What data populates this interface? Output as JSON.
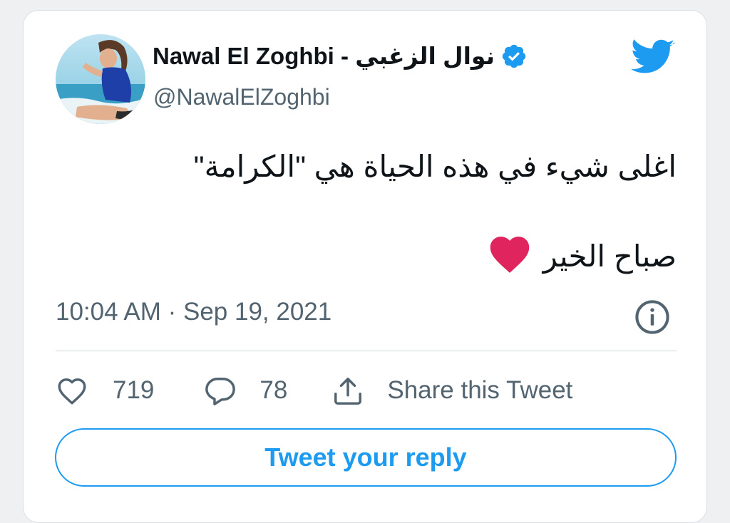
{
  "tweet": {
    "display_name": "Nawal El Zoghbi - نوال الزغبي",
    "handle": "@NawalElZoghbi",
    "verified": true,
    "text_line1": "اغلى شيء في هذه الحياة هي \"الكرامة\"",
    "text_line2": "صباح الخير",
    "emoji": "red-heart",
    "timestamp": "10:04 AM · Sep 19, 2021"
  },
  "actions": {
    "like_count": "719",
    "reply_count": "78",
    "share_label": "Share this Tweet"
  },
  "reply_button": {
    "label": "Tweet your reply"
  },
  "icons": {
    "brand": "twitter-bird-icon",
    "verified": "verified-badge-icon",
    "info": "info-icon",
    "like": "heart-outline-icon",
    "reply": "speech-bubble-icon",
    "share": "share-upload-icon"
  },
  "colors": {
    "brand_blue": "#1d9bf0",
    "heart_red": "#e0245e",
    "text_primary": "#0f1419",
    "text_secondary": "#536471"
  }
}
